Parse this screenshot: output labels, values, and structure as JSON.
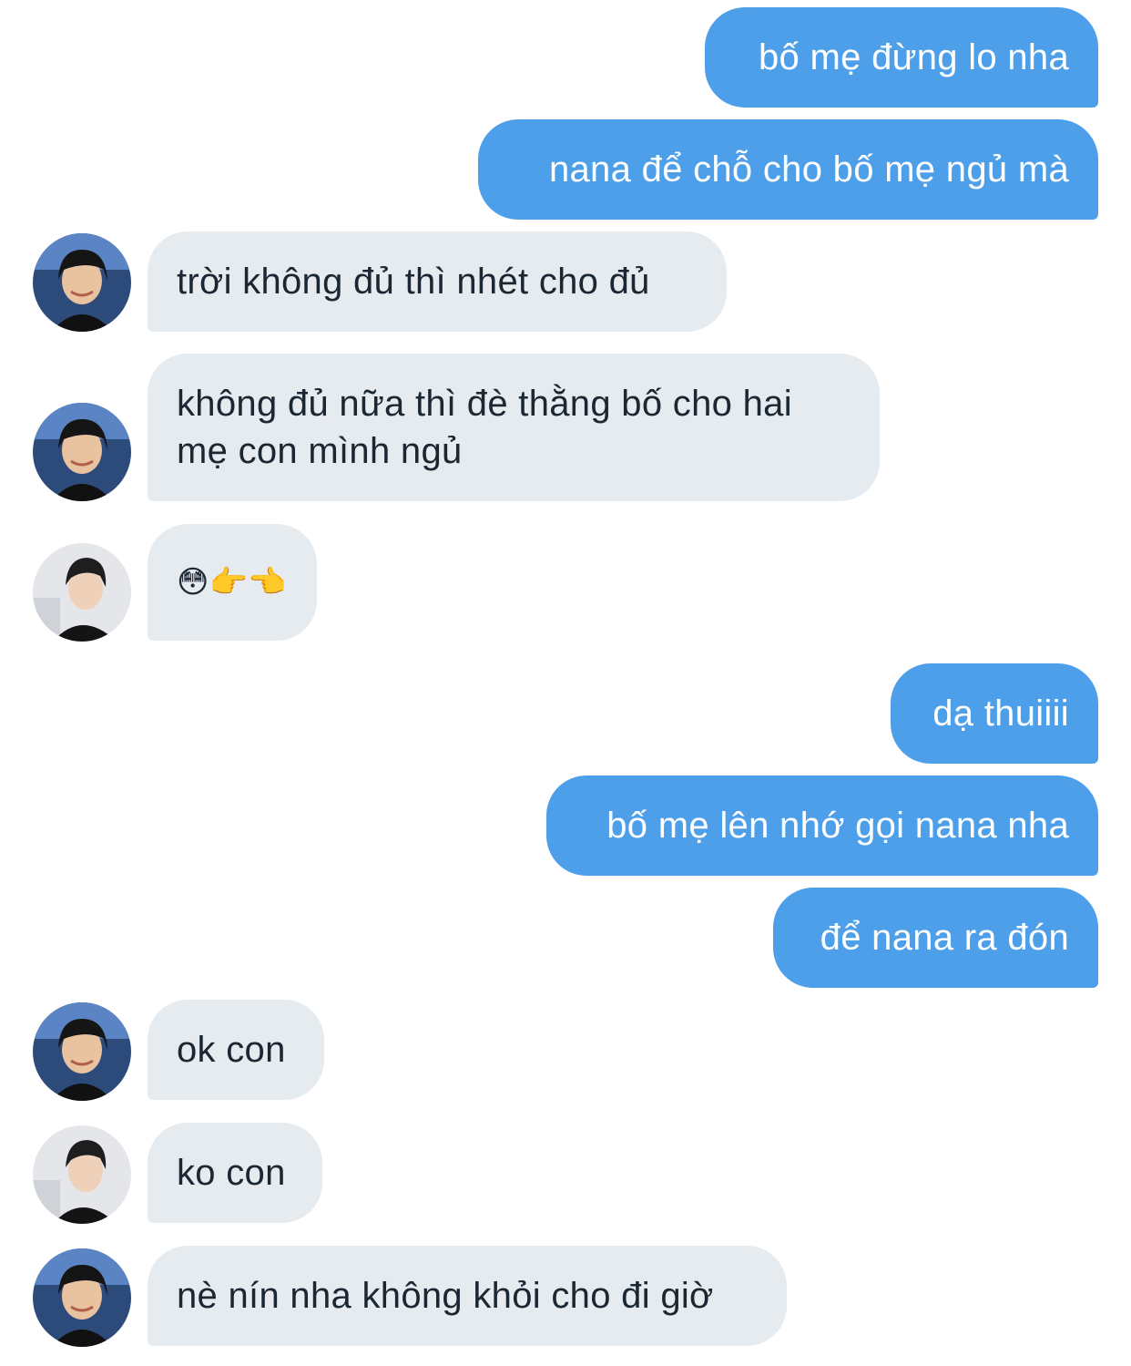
{
  "messages": [
    {
      "side": "out",
      "text": "bố mẹ đừng lo nha"
    },
    {
      "side": "out",
      "text": "nana để chỗ cho bố mẹ ngủ mà"
    },
    {
      "side": "in",
      "avatar": "avatar-a",
      "text": "trời không đủ thì nhét cho đủ"
    },
    {
      "side": "in",
      "avatar": "avatar-a",
      "lines": [
        "không đủ nữa thì đè thằng bố cho hai",
        "mẹ con mình ngủ"
      ]
    },
    {
      "side": "in",
      "avatar": "avatar-b",
      "text": "😳👉👈"
    },
    {
      "side": "out",
      "text": "dạ thuiiii"
    },
    {
      "side": "out",
      "text": "bố mẹ lên nhớ gọi nana nha"
    },
    {
      "side": "out",
      "text": "để nana ra đón"
    },
    {
      "side": "in",
      "avatar": "avatar-a",
      "text": "ok con"
    },
    {
      "side": "in",
      "avatar": "avatar-b",
      "text": "ko con"
    },
    {
      "side": "in",
      "avatar": "avatar-a",
      "text": "nè nín nha không khỏi cho đi giờ"
    }
  ],
  "colors": {
    "outgoing_bubble": "#4d9fea",
    "incoming_bubble": "#e6ebef",
    "incoming_text": "#1b2733",
    "outgoing_text": "#ffffff"
  }
}
